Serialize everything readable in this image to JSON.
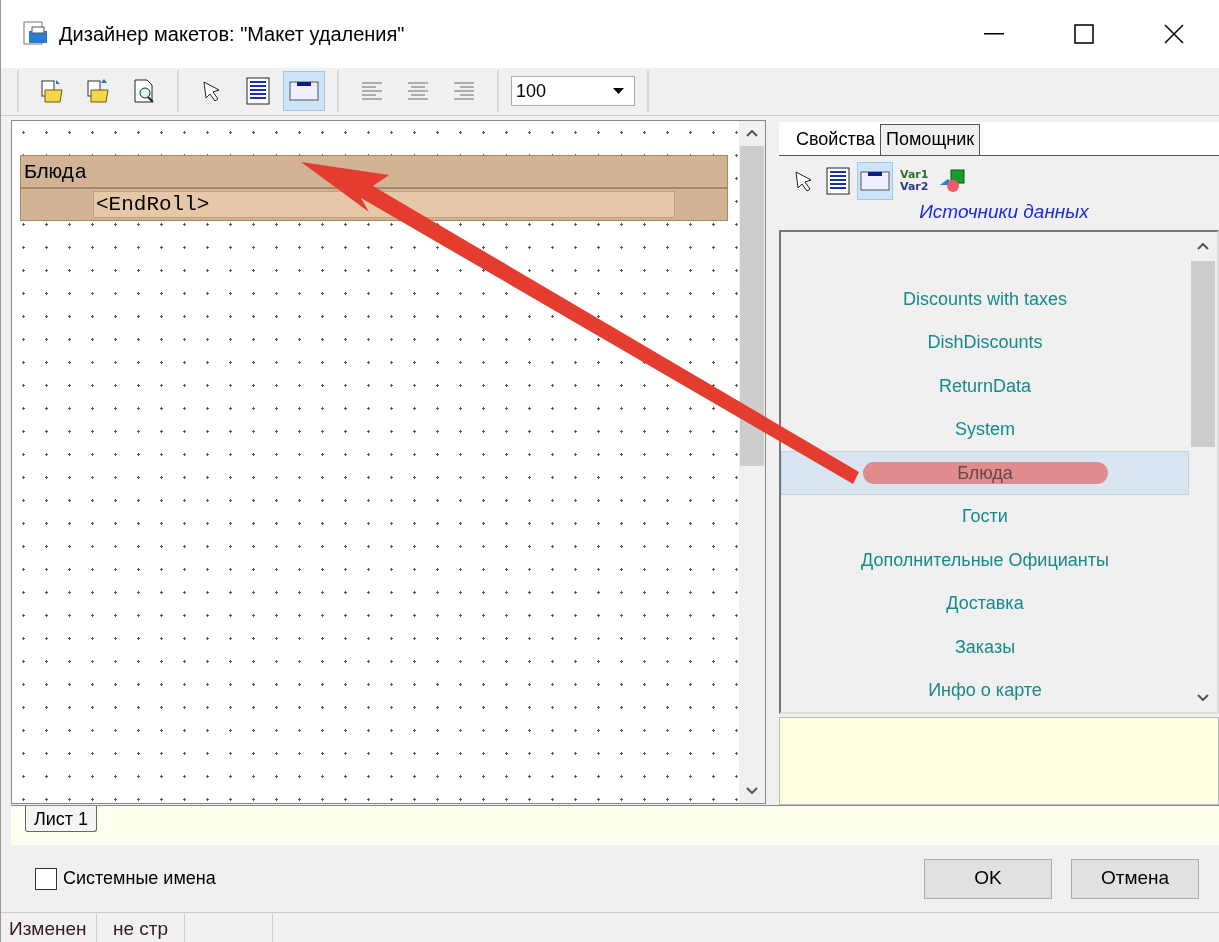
{
  "window": {
    "title": "Дизайнер макетов: \"Макет удаления\""
  },
  "toolbar": {
    "groups": [
      [
        {
          "kind": "open",
          "selected": false
        },
        {
          "kind": "save",
          "selected": false
        },
        {
          "kind": "preview",
          "selected": false
        }
      ],
      [
        {
          "kind": "pointer",
          "selected": false
        },
        {
          "kind": "text",
          "selected": false
        },
        {
          "kind": "band",
          "selected": true
        }
      ],
      [
        {
          "kind": "left",
          "selected": false
        },
        {
          "kind": "center",
          "selected": false
        },
        {
          "kind": "right",
          "selected": false
        }
      ]
    ],
    "zoom": "100"
  },
  "canvas": {
    "band": {
      "title": "Блюда",
      "field": "<EndRoll>"
    }
  },
  "side_tabs": [
    {
      "label": "Свойства",
      "selected": false
    },
    {
      "label": "Помощник",
      "selected": true
    }
  ],
  "helper_tools": [
    {
      "kind": "pointer",
      "selected": false
    },
    {
      "kind": "text",
      "selected": false
    },
    {
      "kind": "band",
      "selected": true
    },
    {
      "kind": "variables",
      "selected": false,
      "lines": [
        "Var1",
        "Var2"
      ]
    },
    {
      "kind": "shapes",
      "selected": false
    }
  ],
  "data_sources": {
    "title": "Источники данных",
    "items": [
      {
        "label": "Discounts with taxes",
        "selected": false,
        "marked": false
      },
      {
        "label": "DishDiscounts",
        "selected": false,
        "marked": false
      },
      {
        "label": "ReturnData",
        "selected": false,
        "marked": false
      },
      {
        "label": "System",
        "selected": false,
        "marked": false
      },
      {
        "label": "Блюда",
        "selected": true,
        "marked": true
      },
      {
        "label": "Гости",
        "selected": false,
        "marked": false
      },
      {
        "label": "Дополнительные Официанты",
        "selected": false,
        "marked": false
      },
      {
        "label": "Доставка",
        "selected": false,
        "marked": false
      },
      {
        "label": "Заказы",
        "selected": false,
        "marked": false
      },
      {
        "label": "Инфо о карте",
        "selected": false,
        "marked": false
      }
    ]
  },
  "sheet_tabs": [
    {
      "label": "Лист 1",
      "selected": true
    }
  ],
  "system_names": {
    "label": "Системные имена",
    "checked": false
  },
  "buttons": [
    {
      "label": "OK"
    },
    {
      "label": "Отмена"
    }
  ],
  "status_bar": [
    "Изменен",
    "не стр"
  ],
  "annotation": {
    "arrow": true
  }
}
